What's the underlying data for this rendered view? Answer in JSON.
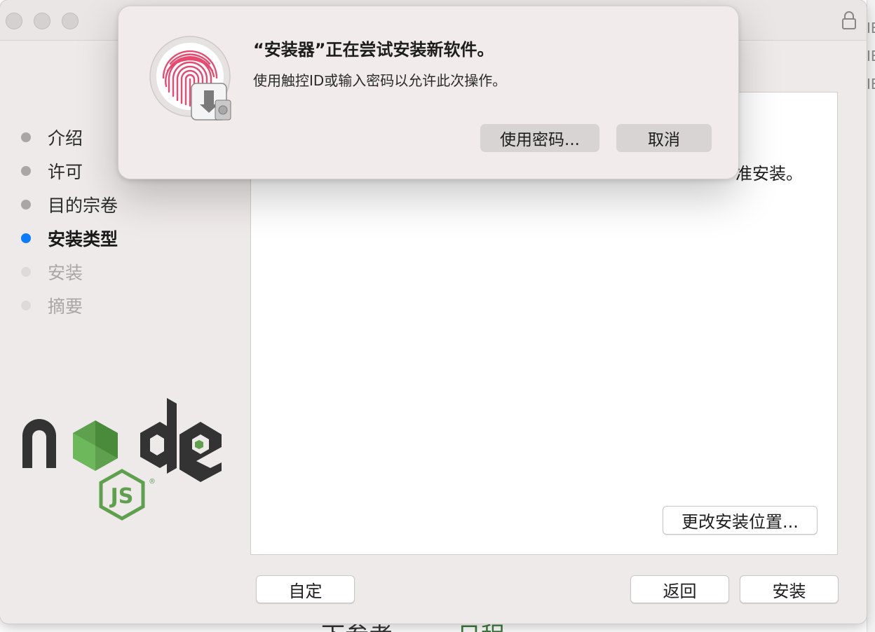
{
  "background": {
    "right_edge_letters": [
      "IE",
      "IE",
      "IE"
    ],
    "bottom_text_left": "下参考",
    "bottom_text_right": "日程"
  },
  "window": {
    "steps": [
      {
        "label": "介绍",
        "state": "done"
      },
      {
        "label": "许可",
        "state": "done"
      },
      {
        "label": "目的宗卷",
        "state": "done"
      },
      {
        "label": "安装类型",
        "state": "current"
      },
      {
        "label": "安装",
        "state": "future"
      },
      {
        "label": "摘要",
        "state": "future"
      }
    ],
    "content_text_fragment": "准安装。",
    "change_location_label": "更改安装位置...",
    "customize_label": "自定",
    "back_label": "返回",
    "install_label": "安装",
    "logo_icon": "nodejs-logo",
    "lock_icon": "lock-icon",
    "accent_color": "#0a7aff"
  },
  "auth_dialog": {
    "title": "“安装器”正在尝试安装新软件。",
    "message": "使用触控ID或输入密码以允许此次操作。",
    "use_password_label": "使用密码...",
    "cancel_label": "取消",
    "icon": "touch-id-fingerprint-icon"
  }
}
